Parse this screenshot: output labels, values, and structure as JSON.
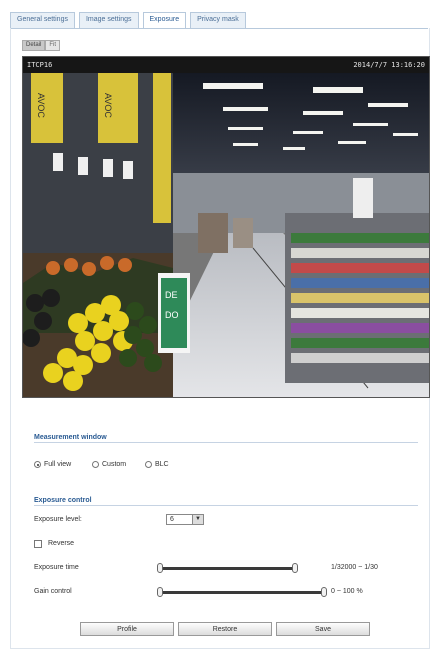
{
  "tabs": [
    "General settings",
    "Image settings",
    "Exposure",
    "Privacy mask"
  ],
  "view_modes": [
    "Detail",
    "Fit"
  ],
  "video": {
    "overlay_left": "ITCP16",
    "overlay_right": "2014/7/7 13:16:20"
  },
  "measurement": {
    "title": "Measurement window",
    "options": [
      "Full view",
      "Custom",
      "BLC"
    ],
    "selected": "Full view"
  },
  "exposure": {
    "title": "Exposure control",
    "level_label": "Exposure level:",
    "level_value": "6",
    "reverse_label": "Reverse",
    "time_label": "Exposure time",
    "time_range": "1/32000 ~ 1/30",
    "gain_label": "Gain control",
    "gain_range": "0 ~ 100 %",
    "time_slider_value": 0.98,
    "gain_slider_value": 1.0
  },
  "buttons": {
    "profile": "Profile",
    "restore": "Restore",
    "save": "Save"
  },
  "colors": {
    "accent": "#2a5b93",
    "tab_bg": "#e9f0f7"
  }
}
